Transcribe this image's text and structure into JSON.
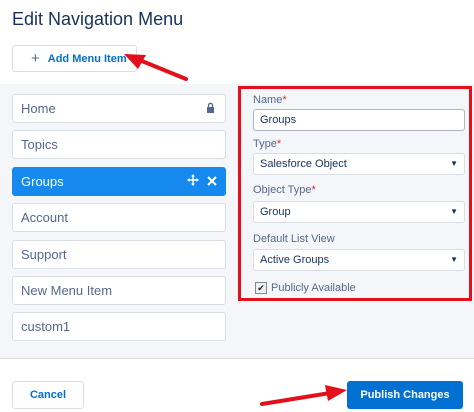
{
  "dialog": {
    "title": "Edit Navigation Menu",
    "add_button_label": "Add Menu Item",
    "cancel_label": "Cancel",
    "publish_label": "Publish Changes"
  },
  "menu_items": [
    {
      "label": "Home",
      "icon": "lock-icon"
    },
    {
      "label": "Topics"
    },
    {
      "label": "Groups",
      "selected": true,
      "icons": [
        "move-icon",
        "close-icon"
      ]
    },
    {
      "label": "Account"
    },
    {
      "label": "Support"
    },
    {
      "label": "New Menu Item"
    },
    {
      "label": "custom1"
    }
  ],
  "form": {
    "name_label": "Name",
    "name_value": "Groups",
    "type_label": "Type",
    "type_value": "Salesforce Object",
    "object_type_label": "Object Type",
    "object_type_value": "Group",
    "default_list_view_label": "Default List View",
    "default_list_view_value": "Active Groups",
    "publicly_available_label": "Publicly Available",
    "publicly_available_checked": true,
    "required_marker": "*"
  },
  "colors": {
    "accent": "#0070d2",
    "selected_item": "#1589ee",
    "annotation_red": "#e3101c"
  }
}
